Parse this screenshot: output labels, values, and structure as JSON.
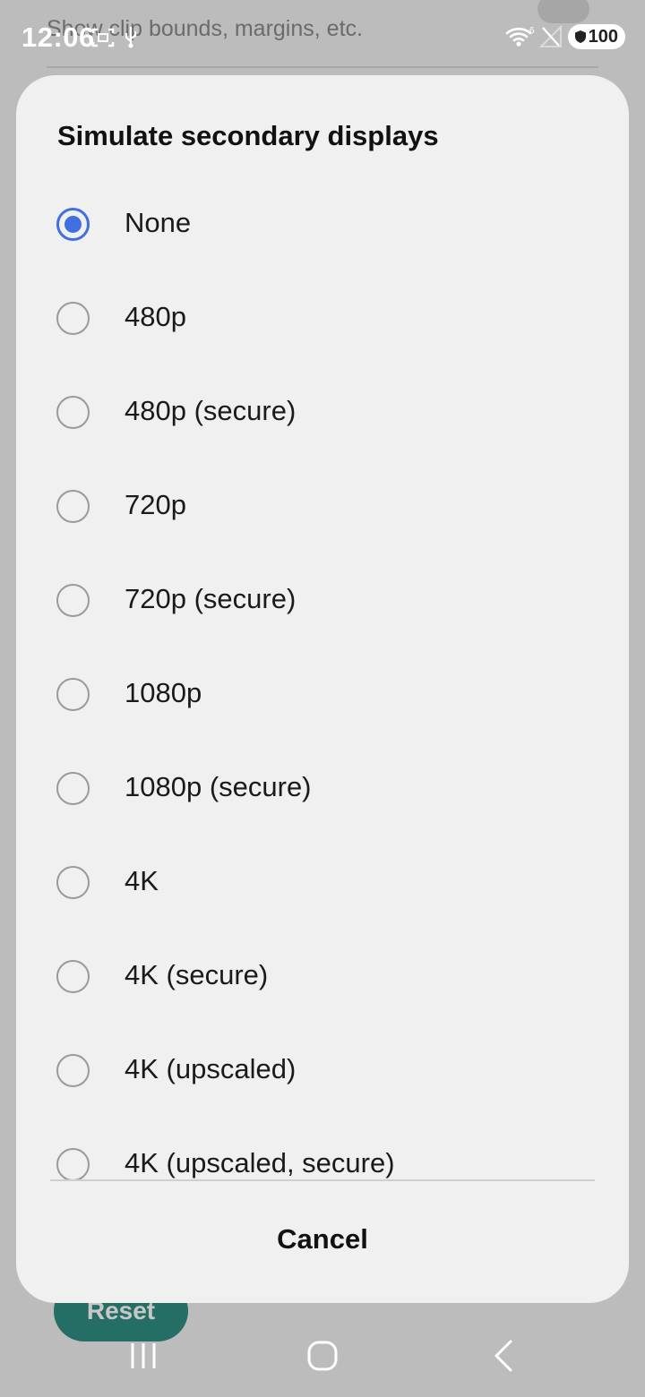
{
  "background": {
    "item_description": "Show clip bounds, margins, etc.",
    "reset_label": "Reset"
  },
  "status_bar": {
    "time": "12:06",
    "battery_level": "100",
    "wifi_badge": "6",
    "icons": [
      "screenshot-icon",
      "usb-icon",
      "wifi-icon",
      "no-signal-icon",
      "battery-shield-icon"
    ]
  },
  "dialog": {
    "title": "Simulate secondary displays",
    "options": [
      {
        "label": "None",
        "selected": true
      },
      {
        "label": "480p",
        "selected": false
      },
      {
        "label": "480p (secure)",
        "selected": false
      },
      {
        "label": "720p",
        "selected": false
      },
      {
        "label": "720p (secure)",
        "selected": false
      },
      {
        "label": "1080p",
        "selected": false
      },
      {
        "label": "1080p (secure)",
        "selected": false
      },
      {
        "label": "4K",
        "selected": false
      },
      {
        "label": "4K (secure)",
        "selected": false
      },
      {
        "label": "4K (upscaled)",
        "selected": false
      },
      {
        "label": "4K (upscaled, secure)",
        "selected": false
      }
    ],
    "cancel_label": "Cancel"
  },
  "nav_bar": {
    "buttons": [
      "recents-icon",
      "home-icon",
      "back-icon"
    ]
  },
  "colors": {
    "accent": "#3f6fe0",
    "reset_button": "#2f8e82",
    "dialog_bg": "#f0f0f0"
  }
}
